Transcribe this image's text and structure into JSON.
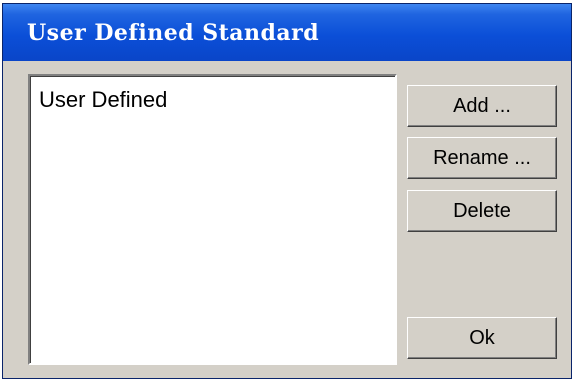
{
  "window": {
    "title": "User Defined Standard"
  },
  "list": {
    "items": [
      {
        "label": "User Defined"
      }
    ]
  },
  "buttons": {
    "add": "Add ...",
    "rename": "Rename ...",
    "delete": "Delete",
    "ok": "Ok"
  },
  "colors": {
    "titlebar": "#0b4fd8",
    "dialog_background": "#d4d0c8",
    "list_background": "#ffffff"
  }
}
